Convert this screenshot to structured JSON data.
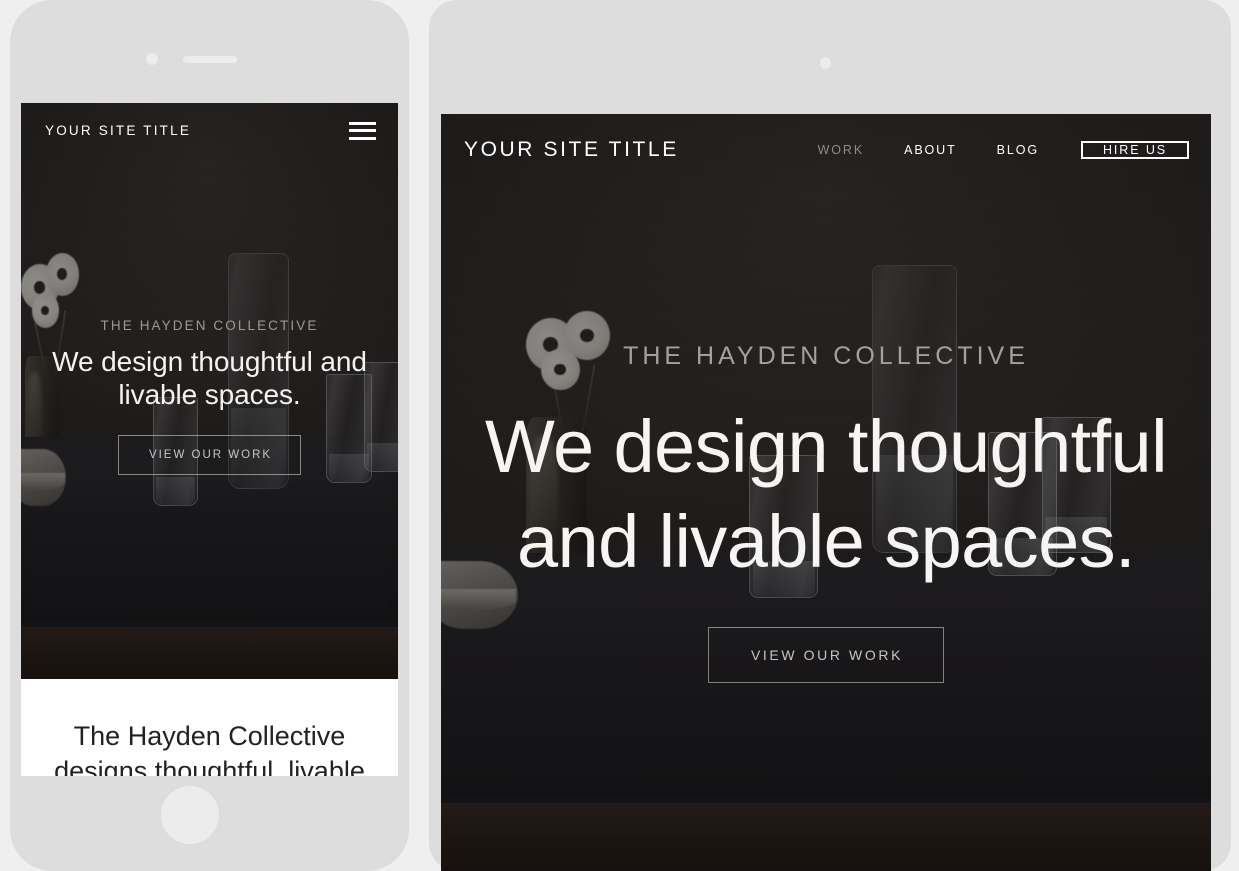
{
  "background_color": "#efefef",
  "device_bezel_color": "#dddddd",
  "site_dark_color": "#221f1f",
  "mobile": {
    "device": "phone",
    "header": {
      "logo": "YOUR SITE TITLE",
      "menu_icon": "hamburger-menu-icon"
    },
    "hero": {
      "eyebrow": "THE HAYDEN COLLECTIVE",
      "headline": "We design thoughtful and livable spaces.",
      "cta_label": "VIEW OUR WORK",
      "background_image": "dark-still-life-table-with-glassware-and-anemone-flowers"
    },
    "below_fold": {
      "title": "The Hayden Collective",
      "subtitle_partial": "designs thoughtful, livable interiors"
    }
  },
  "desktop": {
    "device": "tablet",
    "header": {
      "logo": "YOUR SITE TITLE",
      "nav": [
        {
          "label": "WORK",
          "state": "dimmed"
        },
        {
          "label": "ABOUT",
          "state": "default"
        },
        {
          "label": "BLOG",
          "state": "default"
        }
      ],
      "cta_label": "HIRE US"
    },
    "hero": {
      "eyebrow": "THE HAYDEN COLLECTIVE",
      "headline_line1": "We design thoughtful",
      "headline_line2": "and livable spaces.",
      "cta_label": "VIEW OUR WORK",
      "background_image": "dark-still-life-table-with-glassware-and-anemone-flowers"
    }
  }
}
